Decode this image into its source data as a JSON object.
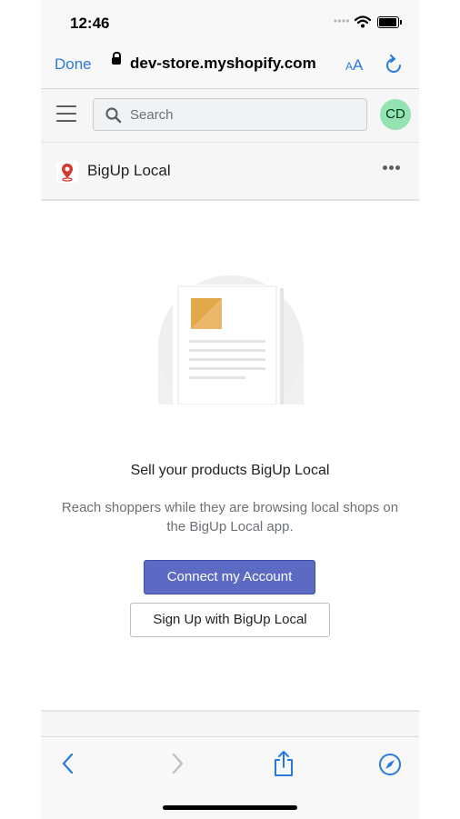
{
  "status": {
    "time": "12:46"
  },
  "browser": {
    "done_label": "Done",
    "url": "dev-store.myshopify.com",
    "aa_label_small": "A",
    "aa_label_big": "A"
  },
  "topbar": {
    "search_placeholder": "Search",
    "avatar_initials": "CD"
  },
  "app": {
    "title": "BigUp Local"
  },
  "empty_state": {
    "heading": "Sell your products BigUp Local",
    "description": "Reach shoppers while they are browsing local shops on the BigUp Local app.",
    "primary_button": "Connect my Account",
    "secondary_button": "Sign Up with BigUp Local"
  },
  "colors": {
    "accent_blue": "#2a7ade",
    "primary_button": "#5c6ac4",
    "avatar_bg": "#93e3b3",
    "illustration_square": "#e3a84a",
    "pin_red": "#d4392b"
  },
  "icons": [
    "lock-icon",
    "reload-icon",
    "menu-icon",
    "search-icon",
    "map-pin-icon",
    "more-icon",
    "back-icon",
    "forward-icon",
    "share-icon",
    "compass-icon",
    "wifi-icon",
    "battery-icon"
  ]
}
